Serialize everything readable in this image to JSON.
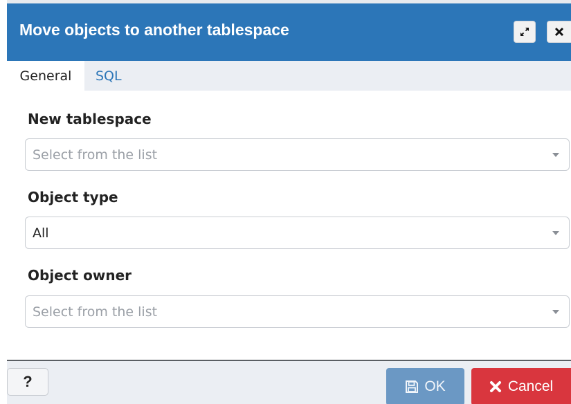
{
  "dialog": {
    "title": "Move objects to another tablespace",
    "maximize_icon": "maximize-icon",
    "close_icon": "close-icon"
  },
  "tabs": [
    {
      "label": "General",
      "active": true
    },
    {
      "label": "SQL",
      "active": false
    }
  ],
  "fields": {
    "new_tablespace": {
      "label": "New tablespace",
      "placeholder": "Select from the list",
      "value": ""
    },
    "object_type": {
      "label": "Object type",
      "value": "All"
    },
    "object_owner": {
      "label": "Object owner",
      "placeholder": "Select from the list",
      "value": ""
    }
  },
  "footer": {
    "help_label": "?",
    "ok_label": "OK",
    "ok_icon": "save-icon",
    "cancel_label": "Cancel",
    "cancel_icon": "cancel-x-icon"
  },
  "colors": {
    "titlebar": "#2c76b8",
    "ok_button": "#6b98c4",
    "cancel_button": "#d9363e",
    "tab_link": "#2c76b8"
  }
}
